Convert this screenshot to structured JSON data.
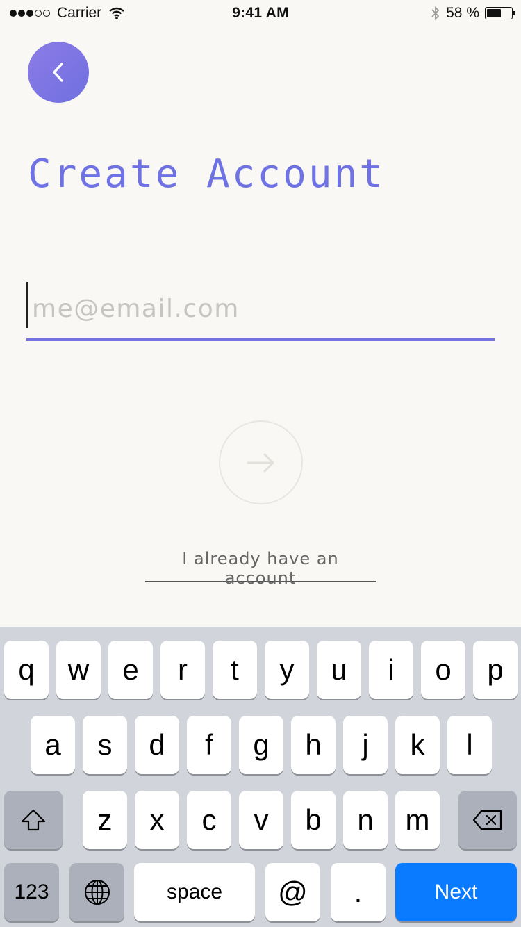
{
  "status_bar": {
    "carrier": "Carrier",
    "time": "9:41 AM",
    "battery": "58 %",
    "battery_level": 0.58,
    "icons": [
      "wifi-icon",
      "bluetooth-icon",
      "battery-icon"
    ]
  },
  "header": {
    "back_icon": "chevron-left-icon",
    "title": "Create Account"
  },
  "form": {
    "email_placeholder": "me@email.com",
    "email_value": "",
    "submit_icon": "arrow-right-icon",
    "login_link": "I already have an account"
  },
  "colors": {
    "accent": "#6f72e4",
    "background": "#f9f8f5",
    "keyboard_bg": "#d1d4db",
    "next_key": "#0a7bff"
  },
  "keyboard": {
    "row1": [
      "q",
      "w",
      "e",
      "r",
      "t",
      "y",
      "u",
      "i",
      "o",
      "p"
    ],
    "row2": [
      "a",
      "s",
      "d",
      "f",
      "g",
      "h",
      "j",
      "k",
      "l"
    ],
    "row3": [
      "z",
      "x",
      "c",
      "v",
      "b",
      "n",
      "m"
    ],
    "numbers_key": "123",
    "space_key": "space",
    "at_key": "@",
    "period_key": ".",
    "next_key": "Next"
  }
}
